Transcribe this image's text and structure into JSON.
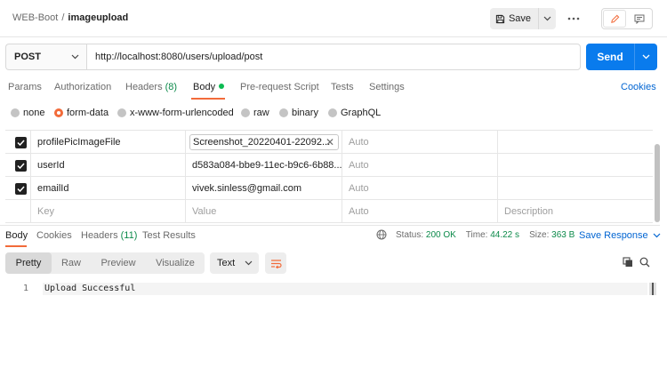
{
  "breadcrumb": {
    "collection": "WEB-Boot",
    "separator": "/",
    "request": "imageupload"
  },
  "toolbar": {
    "save_label": "Save"
  },
  "request": {
    "method": "POST",
    "url": "http://localhost:8080/users/upload/post",
    "send_label": "Send"
  },
  "request_tabs": {
    "params": "Params",
    "authorization": "Authorization",
    "headers": "Headers",
    "headers_count": "(8)",
    "body": "Body",
    "pre_request": "Pre-request Script",
    "tests": "Tests",
    "settings": "Settings",
    "cookies": "Cookies"
  },
  "body_types": {
    "none": "none",
    "form_data": "form-data",
    "urlencoded": "x-www-form-urlencoded",
    "raw": "raw",
    "binary": "binary",
    "graphql": "GraphQL",
    "selected": "form-data"
  },
  "params": {
    "rows": [
      {
        "key": "profilePicImageFile",
        "value": "Screenshot_20220401-22092...",
        "content_type": "Auto",
        "checked": true,
        "is_file": true
      },
      {
        "key": "userId",
        "value": "d583a084-bbe9-11ec-b9c6-6b88...",
        "content_type": "Auto",
        "checked": true
      },
      {
        "key": "emailId",
        "value": "vivek.sinless@gmail.com",
        "content_type": "Auto",
        "checked": true
      }
    ],
    "placeholder": {
      "key": "Key",
      "value": "Value",
      "content_type": "Auto",
      "description": "Description"
    }
  },
  "response_tabs": {
    "body": "Body",
    "cookies": "Cookies",
    "headers": "Headers",
    "headers_count": "(11)",
    "test_results": "Test Results"
  },
  "response_status": {
    "status_label": "Status:",
    "status_value": "200 OK",
    "time_label": "Time:",
    "time_value": "44.22 s",
    "size_label": "Size:",
    "size_value": "363 B",
    "save_response": "Save Response"
  },
  "response_format": {
    "pretty": "Pretty",
    "raw": "Raw",
    "preview": "Preview",
    "visualize": "Visualize",
    "language": "Text"
  },
  "response_body": {
    "line_number": "1",
    "text": "Upload Successful"
  },
  "colors": {
    "accent": "#f26b3a",
    "send": "#097bed",
    "success": "#0c8a4a",
    "link": "#0265d2"
  }
}
